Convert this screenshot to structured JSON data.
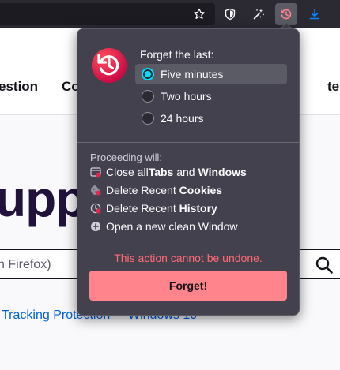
{
  "website": {
    "nav_item_1": "estion",
    "nav_item_2": "Co",
    "nav_item_3": "te",
    "big_title": "upp",
    "search_placeholder": "n Firefox)",
    "tag_1": "Tracking Protection",
    "tag_2": "Windows 10"
  },
  "forget_panel": {
    "heading": "Forget the last:",
    "options": [
      {
        "label": "Five minutes",
        "selected": true
      },
      {
        "label": "Two hours",
        "selected": false
      },
      {
        "label": "24 hours",
        "selected": false
      }
    ],
    "proceeding_label": "Proceeding will:",
    "actions": [
      {
        "prefix": "Close all ",
        "bold1": "Tabs",
        "middle": " and ",
        "bold2": "Windows",
        "icon": "tabs-close-icon"
      },
      {
        "prefix": "Delete Recent ",
        "bold1": "Cookies",
        "middle": "",
        "bold2": "",
        "icon": "cookie-delete-icon"
      },
      {
        "prefix": "Delete Recent ",
        "bold1": "History",
        "middle": "",
        "bold2": "",
        "icon": "history-delete-icon"
      },
      {
        "prefix": "Open a new clean Window",
        "bold1": "",
        "middle": "",
        "bold2": "",
        "icon": "plus-circle-icon"
      }
    ],
    "warning": "This action cannot be undone.",
    "forget_button": "Forget!"
  },
  "colors": {
    "panel_bg": "#42414d",
    "accent": "#00ddff",
    "warning": "#ff6a75",
    "forget_button": "#ff848b"
  }
}
